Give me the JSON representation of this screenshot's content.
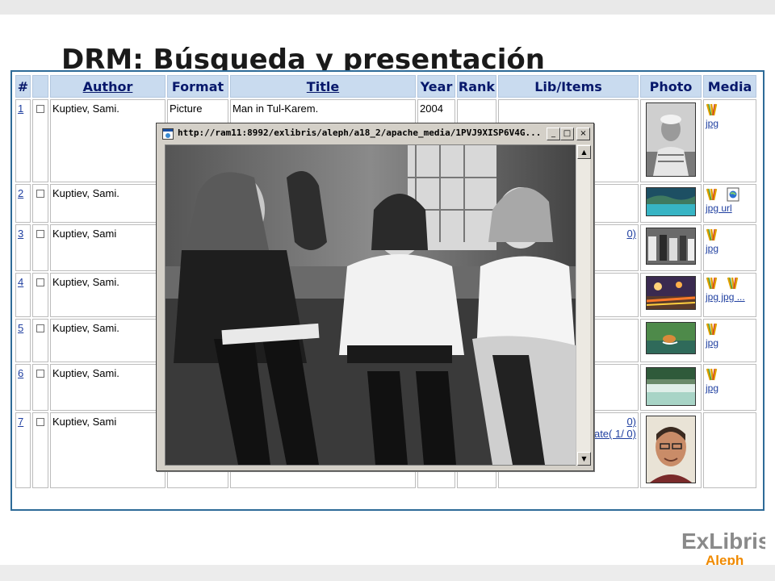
{
  "slide": {
    "title": "DRM: Búsqueda y presentación"
  },
  "table": {
    "headers": {
      "num": "#",
      "author": "Author",
      "format": "Format",
      "title": "Title",
      "year": "Year",
      "rank": "Rank",
      "lib": "Lib/Items",
      "photo": "Photo",
      "media": "Media"
    },
    "rows": [
      {
        "num": "1",
        "author": "Kuptiev, Sami.",
        "format": "Picture",
        "title": "Man in Tul-Karem.",
        "year": "2004",
        "lib_items": "",
        "media_label": "jpg"
      },
      {
        "num": "2",
        "author": "Kuptiev, Sami.",
        "format": "",
        "title": "",
        "year": "",
        "lib_items": "",
        "media_label": "jpg url"
      },
      {
        "num": "3",
        "author": "Kuptiev, Sami",
        "format": "",
        "title": "",
        "year": "",
        "lib_items": "0)",
        "media_label": "jpg"
      },
      {
        "num": "4",
        "author": "Kuptiev, Sami.",
        "format": "",
        "title": "",
        "year": "",
        "lib_items": "",
        "media_label": "jpg jpg ..."
      },
      {
        "num": "5",
        "author": "Kuptiev, Sami.",
        "format": "",
        "title": "",
        "year": "",
        "lib_items": "",
        "media_label": "jpg"
      },
      {
        "num": "6",
        "author": "Kuptiev, Sami.",
        "format": "",
        "title": "",
        "year": "",
        "lib_items": "",
        "media_label": "jpg"
      },
      {
        "num": "7",
        "author": "Kuptiev, Sami",
        "format": "",
        "title": "",
        "year": "",
        "lib_items": "0)",
        "lib_items_2": "ate( 1/ 0)",
        "media_label": ""
      }
    ]
  },
  "popup": {
    "title": "http://ram11:8992/exlibris/aleph/a18_2/apache_media/1PVJ9XISP6V4G...",
    "minimize": "_",
    "maximize": "□",
    "close": "×",
    "scroll_up": "▲",
    "scroll_down": "▼"
  },
  "logo": {
    "name": "ExLibris",
    "sub": "Aleph"
  },
  "colors": {
    "header_bg": "#c9dbef",
    "header_text": "#07186b",
    "frame_border": "#2e6b98",
    "link": "#1f3fa0",
    "logo_gray": "#8a8a8a",
    "logo_orange": "#f08a00"
  }
}
